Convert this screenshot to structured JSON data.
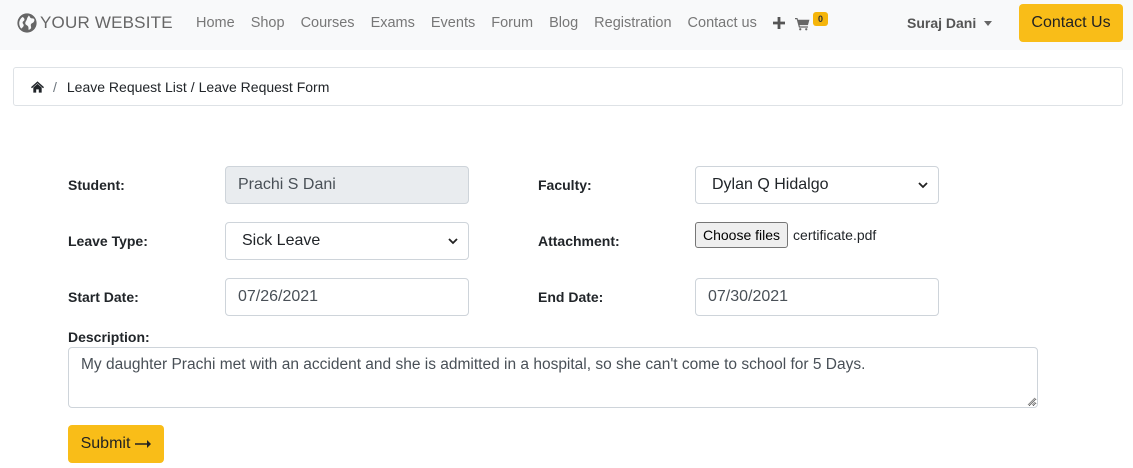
{
  "navbar": {
    "brand": "YOUR WEBSITE",
    "brand_icon": "globe-icon",
    "links": [
      "Home",
      "Shop",
      "Courses",
      "Exams",
      "Events",
      "Forum",
      "Blog",
      "Registration",
      "Contact us"
    ],
    "plus_icon": "plus-icon",
    "cart_icon": "cart-icon",
    "cart_count": "0",
    "user_name": "Suraj Dani",
    "contact_button": "Contact Us"
  },
  "breadcrumb": {
    "home_icon": "home-icon",
    "separator": "/",
    "link": "Leave Request List",
    "inner_separator": "/",
    "current": "Leave Request Form"
  },
  "form": {
    "student_label": "Student:",
    "student_value": "Prachi S Dani",
    "faculty_label": "Faculty:",
    "faculty_value": "Dylan Q Hidalgo",
    "leave_type_label": "Leave Type:",
    "leave_type_value": "Sick Leave",
    "attachment_label": "Attachment:",
    "attachment_button": "Choose files",
    "attachment_file": "certificate.pdf",
    "start_date_label": "Start Date:",
    "start_date_value": "07/26/2021",
    "end_date_label": "End Date:",
    "end_date_value": "07/30/2021",
    "description_label": "Description:",
    "description_value": "My daughter Prachi met with an accident and she is admitted in a hospital, so she can't come to school for 5 Days.",
    "submit_label": "Submit",
    "submit_icon": "arrow-right-icon"
  },
  "colors": {
    "accent": "#f9bd18",
    "navbar_bg": "#f8f9fa",
    "readonly_bg": "#e9ecef"
  }
}
